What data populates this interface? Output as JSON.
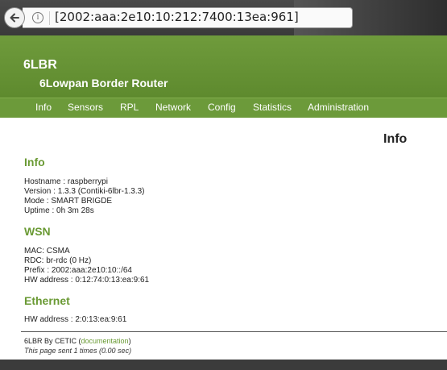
{
  "browser": {
    "url": "[2002:aaa:2e10:10:212:7400:13ea:961]",
    "info_glyph": "i"
  },
  "site": {
    "title": "6LBR",
    "subtitle": "6Lowpan Border Router"
  },
  "nav": {
    "items": [
      "Info",
      "Sensors",
      "RPL",
      "Network",
      "Config",
      "Statistics",
      "Administration"
    ]
  },
  "page": {
    "heading": "Info",
    "sections": {
      "info": {
        "title": "Info",
        "lines": [
          "Hostname : raspberrypi",
          "Version : 1.3.3 (Contiki-6lbr-1.3.3)",
          "Mode : SMART BRIGDE",
          "Uptime : 0h 3m 28s"
        ]
      },
      "wsn": {
        "title": "WSN",
        "lines": [
          "MAC: CSMA",
          "RDC: br-rdc (0 Hz)",
          "Prefix : 2002:aaa:2e10:10::/64",
          "HW address : 0:12:74:0:13:ea:9:61"
        ]
      },
      "ethernet": {
        "title": "Ethernet",
        "lines": [
          "HW address : 2:0:13:ea:9:61"
        ]
      }
    }
  },
  "footer": {
    "prefix": "6LBR By CETIC (",
    "link": "documentation",
    "suffix": ")",
    "sent": "This page sent 1 times (0.00 sec)"
  }
}
